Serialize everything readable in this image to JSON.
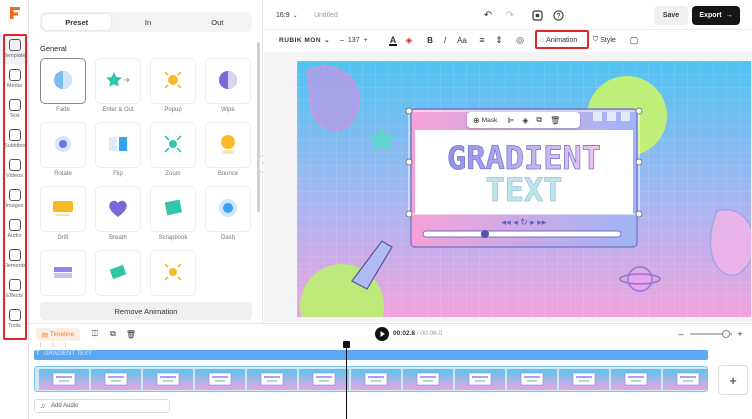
{
  "app": {
    "project_title": "Untitled",
    "aspect_ratio": "16:9"
  },
  "rail": {
    "items": [
      {
        "label": "Template",
        "icon": "template-icon",
        "active": true
      },
      {
        "label": "Media",
        "icon": "folder-icon"
      },
      {
        "label": "Text",
        "icon": "text-icon"
      },
      {
        "label": "Subtitles",
        "icon": "subtitles-icon"
      },
      {
        "label": "Videos",
        "icon": "video-icon"
      },
      {
        "label": "Images",
        "icon": "image-icon"
      },
      {
        "label": "Audio",
        "icon": "music-icon"
      },
      {
        "label": "Elements",
        "icon": "shapes-icon"
      },
      {
        "label": "Effects",
        "icon": "sparkle-icon"
      },
      {
        "label": "Tools",
        "icon": "toolbox-icon"
      }
    ]
  },
  "panel": {
    "tabs": [
      "Preset",
      "In",
      "Out"
    ],
    "active_tab": "Preset",
    "section": "General",
    "animations": [
      "Fade",
      "Enter & Out",
      "Popup",
      "Wipe",
      "Rotate",
      "Flip",
      "Zoom",
      "Bounce",
      "Drift",
      "Breath",
      "Scrapbook",
      "Dash",
      "",
      "",
      ""
    ],
    "remove_label": "Remove Animation"
  },
  "topbar": {
    "save_label": "Save",
    "export_label": "Export"
  },
  "toolbar": {
    "font_name": "RUBIK MON",
    "font_size": "137",
    "animation_label": "Animation",
    "style_label": "Style"
  },
  "canvas": {
    "mask_label": "Mask",
    "headline_line1": "GRADIENT",
    "headline_line2": "TEXT"
  },
  "timeline": {
    "label": "Timeline",
    "current_time": "00:02.8",
    "total_time": "/ 00:06.0",
    "text_clip_label": "GRADIENT TEXT",
    "add_audio_label": "Add Audio"
  },
  "colors": {
    "accent_red": "#e0262b",
    "brand_orange": "#f26a21",
    "clip_blue": "#5aa7f3"
  }
}
